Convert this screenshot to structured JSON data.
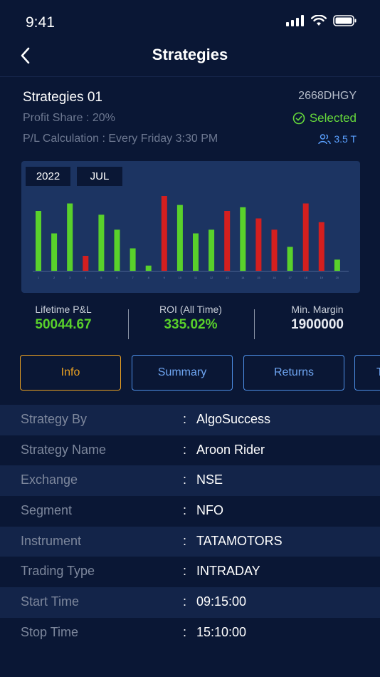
{
  "status_bar": {
    "time": "9:41"
  },
  "nav": {
    "title": "Strategies"
  },
  "strategy": {
    "name": "Strategies 01",
    "code": "2668DHGY",
    "profit_share": "Profit Share : 20%",
    "selected_label": "Selected",
    "pl_calculation": "P/L Calculation : Every Friday 3:30 PM",
    "users": "3.5 T"
  },
  "chart_filters": {
    "year": "2022",
    "month": "JUL"
  },
  "chart_data": {
    "type": "bar",
    "categories": [
      "1",
      "2",
      "3",
      "4",
      "5",
      "6",
      "7",
      "8",
      "9",
      "10",
      "11",
      "12",
      "13",
      "14",
      "15",
      "16",
      "17",
      "18",
      "19",
      "20"
    ],
    "values": [
      80,
      50,
      90,
      -20,
      75,
      55,
      30,
      7,
      -100,
      88,
      50,
      55,
      -80,
      85,
      -70,
      -55,
      32,
      -90,
      -65,
      15
    ],
    "colors": {
      "positive": "#59d12b",
      "negative": "#d41f1f"
    }
  },
  "stats": [
    {
      "label": "Lifetime P&L",
      "value": "50044.67",
      "color": "#59d12b"
    },
    {
      "label": "ROI (All Time)",
      "value": "335.02%",
      "color": "#59d12b"
    },
    {
      "label": "Min. Margin",
      "value": "1900000",
      "color": "#e9ecf2"
    }
  ],
  "tabs": [
    {
      "label": "Info",
      "active": true
    },
    {
      "label": "Summary",
      "active": false
    },
    {
      "label": "Returns",
      "active": false
    },
    {
      "label": "T",
      "active": false
    }
  ],
  "details": [
    {
      "label": "Strategy By",
      "value": "AlgoSuccess"
    },
    {
      "label": "Strategy Name",
      "value": "Aroon Rider"
    },
    {
      "label": "Exchange",
      "value": "NSE"
    },
    {
      "label": "Segment",
      "value": "NFO"
    },
    {
      "label": "Instrument",
      "value": "TATAMOTORS"
    },
    {
      "label": "Trading Type",
      "value": "INTRADAY"
    },
    {
      "label": "Start Time",
      "value": "09:15:00"
    },
    {
      "label": "Stop Time",
      "value": "15:10:00"
    }
  ],
  "colors": {
    "accent": "#e9a022",
    "tab_blue": "#4d8fe6",
    "background": "#0a1735"
  }
}
